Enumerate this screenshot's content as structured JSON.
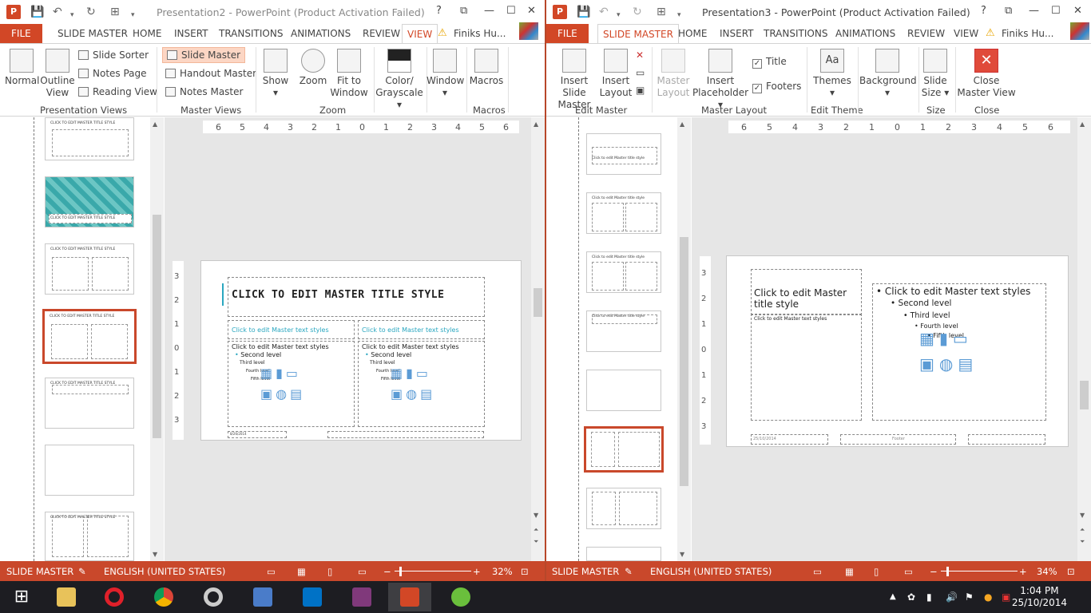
{
  "win1": {
    "title": "Presentation2 - PowerPoint (Product Activation Failed)",
    "tabs": [
      "FILE",
      "SLIDE MASTER",
      "HOME",
      "INSERT",
      "TRANSITIONS",
      "ANIMATIONS",
      "REVIEW",
      "VIEW"
    ],
    "active_tab": "VIEW",
    "user": "Finiks Hu...",
    "ribbon": {
      "normal": "Normal",
      "outline": "Outline View",
      "slide_sorter": "Slide Sorter",
      "notes_page": "Notes Page",
      "reading_view": "Reading View",
      "group_pres_views": "Presentation Views",
      "slide_master": "Slide Master",
      "handout_master": "Handout Master",
      "notes_master": "Notes Master",
      "group_master_views": "Master Views",
      "show": "Show",
      "zoom": "Zoom",
      "fit_window": "Fit to Window",
      "group_zoom": "Zoom",
      "color": "Color/ Grayscale",
      "window": "Window",
      "macros": "Macros",
      "group_macros": "Macros"
    },
    "slide": {
      "title": "CLICK TO EDIT MASTER TITLE STYLE",
      "left_head": "Click to edit Master text styles",
      "right_head": "Click to edit Master text styles",
      "text_styles": "Click to edit Master text styles",
      "second": "Second level",
      "third": "Third level",
      "fourth": "Fourth level",
      "fifth": "Fifth level",
      "date": "8/26/2014"
    },
    "thumb_title": "CLICK TO EDIT MASTER TITLE STYLE",
    "status": {
      "mode": "SLIDE MASTER",
      "lang": "ENGLISH (UNITED STATES)",
      "zoom": "32%"
    }
  },
  "win2": {
    "title": "Presentation3 - PowerPoint (Product Activation Failed)",
    "tabs": [
      "FILE",
      "SLIDE MASTER",
      "HOME",
      "INSERT",
      "TRANSITIONS",
      "ANIMATIONS",
      "REVIEW",
      "VIEW"
    ],
    "active_tab": "SLIDE MASTER",
    "user": "Finiks Hu...",
    "ribbon": {
      "insert_slide_master": "Insert Slide Master",
      "insert_layout": "Insert Layout",
      "group_edit_master": "Edit Master",
      "master_layout": "Master Layout",
      "insert_placeholder": "Insert Placeholder",
      "title": "Title",
      "footers": "Footers",
      "group_master_layout": "Master Layout",
      "themes": "Themes",
      "group_edit_theme": "Edit Theme",
      "background": "Background",
      "slide_size": "Slide Size",
      "group_size": "Size",
      "close_master": "Close Master View",
      "group_close": "Close"
    },
    "slide": {
      "title": "Click to edit Master title style",
      "sub": "Click to edit Master text styles",
      "text_styles": "Click to edit Master text styles",
      "second": "Second level",
      "third": "Third level",
      "fourth": "Fourth level",
      "fifth": "Fifth level",
      "date": "25/10/2014",
      "footer": "Footer"
    },
    "thumb_title": "Click to edit Master title style",
    "status": {
      "mode": "SLIDE MASTER",
      "lang": "ENGLISH (UNITED STATES)",
      "zoom": "34%"
    }
  },
  "rulers": {
    "h1": [
      "6",
      "5",
      "4",
      "3",
      "2",
      "1",
      "0",
      "1",
      "2",
      "3",
      "4",
      "5",
      "6"
    ],
    "v": [
      "3",
      "2",
      "1",
      "0",
      "1",
      "2",
      "3"
    ]
  },
  "clock": {
    "time": "1:04 PM",
    "date": "25/10/2014"
  },
  "colors": {
    "accent": "#d24726",
    "status": "#c9482b",
    "taskbar": "#1d1d22"
  }
}
